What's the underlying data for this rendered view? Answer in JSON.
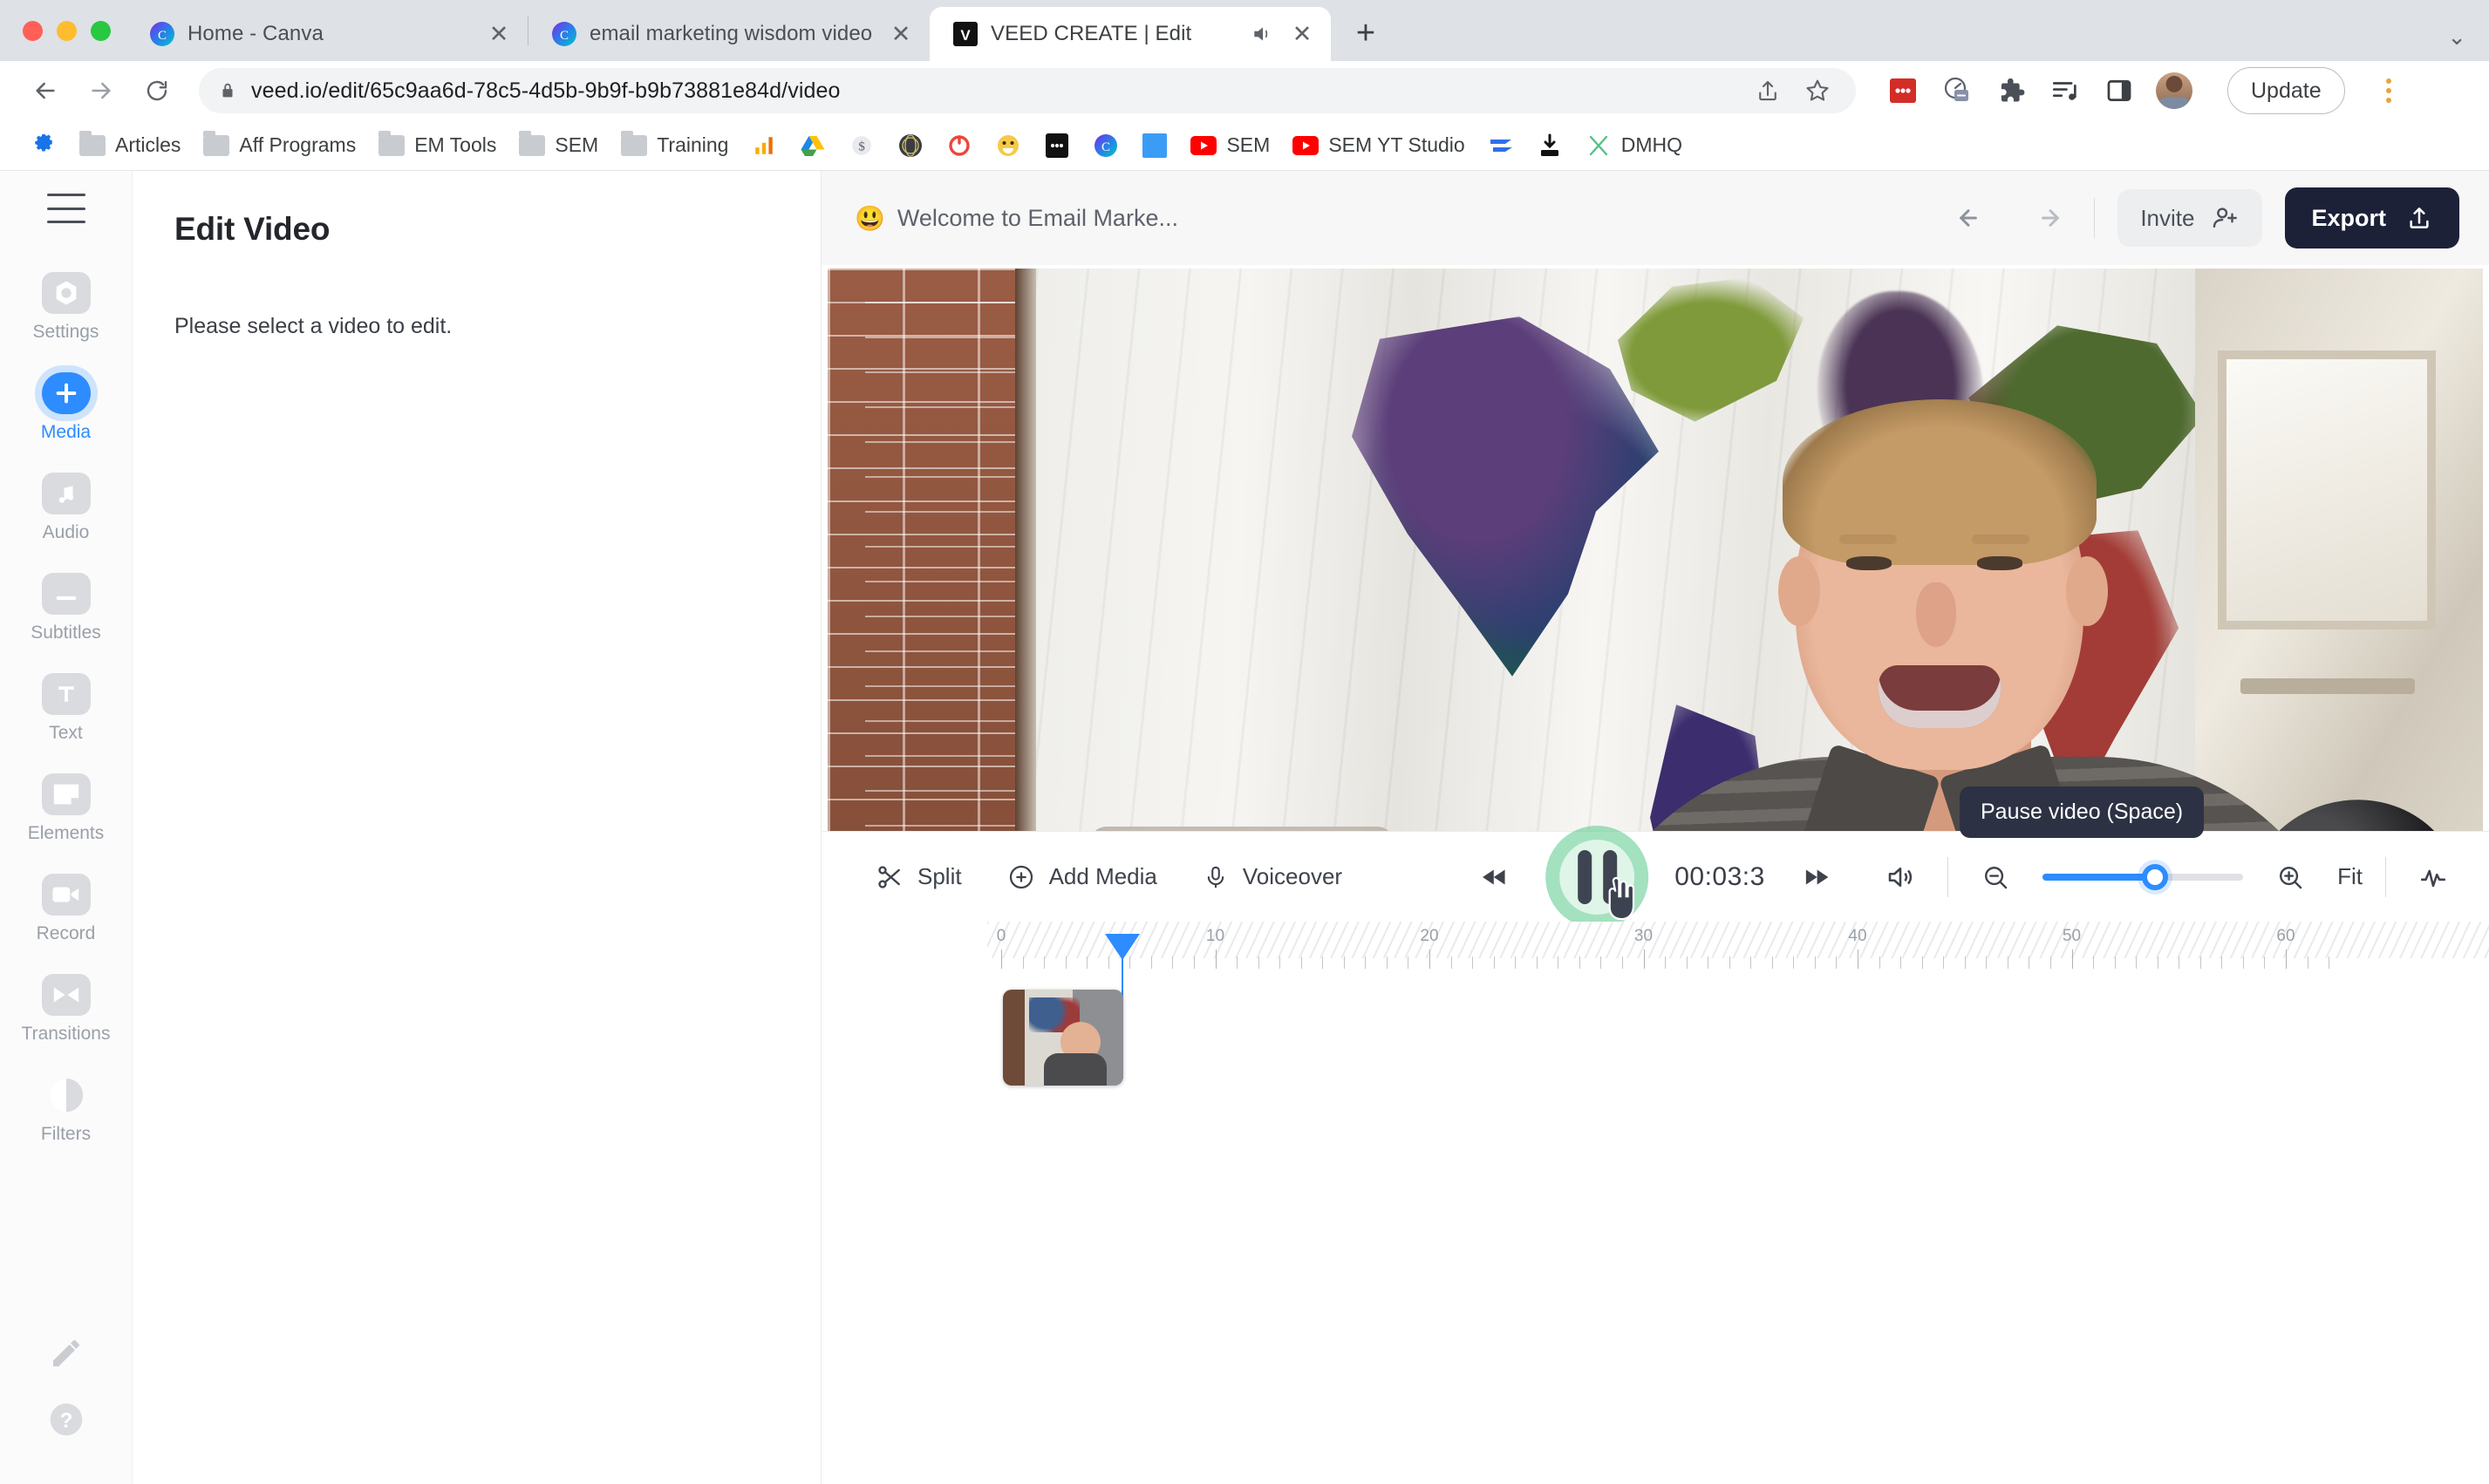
{
  "browser": {
    "tabs": [
      {
        "title": "Home - Canva",
        "favicon": "canva-icon",
        "active": false,
        "muted": false
      },
      {
        "title": "email marketing wisdom video",
        "favicon": "canva-icon",
        "active": false,
        "muted": false
      },
      {
        "title": "VEED CREATE | Edit",
        "favicon": "veed-icon",
        "active": true,
        "muted": true
      }
    ],
    "new_tab_label": "+",
    "tab_list_chevron": "chevron-down-icon",
    "nav": {
      "back": "back-arrow-icon",
      "forward": "forward-arrow-icon",
      "reload": "reload-icon"
    },
    "omnibox": {
      "url": "veed.io/edit/65c9aa6d-78c5-4d5b-9b9f-b9b73881e84d/video",
      "lock": "lock-icon",
      "share": "share-icon",
      "bookmark": "star-icon"
    },
    "extensions": [
      "lastpass-icon",
      "speed-dial-icon",
      "puzzle-extensions-icon",
      "reading-list-icon",
      "side-panel-icon"
    ],
    "profile": "profile-avatar",
    "update_label": "Update",
    "menu": "kebab-menu-icon",
    "bookmarks": [
      {
        "label": "",
        "icon": "settings-gear-icon"
      },
      {
        "label": "Articles",
        "icon": "folder-icon"
      },
      {
        "label": "Aff Programs",
        "icon": "folder-icon"
      },
      {
        "label": "EM Tools",
        "icon": "folder-icon"
      },
      {
        "label": "SEM",
        "icon": "folder-icon"
      },
      {
        "label": "Training",
        "icon": "folder-icon"
      },
      {
        "label": "",
        "icon": "analytics-icon"
      },
      {
        "label": "",
        "icon": "google-drive-icon"
      },
      {
        "label": "",
        "icon": "dollar-icon"
      },
      {
        "label": "",
        "icon": "dark-globe-icon"
      },
      {
        "label": "",
        "icon": "red-circle-icon"
      },
      {
        "label": "",
        "icon": "smiley-icon"
      },
      {
        "label": "",
        "icon": "black-app-icon"
      },
      {
        "label": "",
        "icon": "canva-icon"
      },
      {
        "label": "",
        "icon": "blue-square-icon"
      },
      {
        "label": "SEM",
        "icon": "youtube-icon"
      },
      {
        "label": "SEM YT Studio",
        "icon": "youtube-icon"
      },
      {
        "label": "",
        "icon": "blue-arrows-icon"
      },
      {
        "label": "",
        "icon": "download-icon"
      },
      {
        "label": "DMHQ",
        "icon": "x-icon"
      }
    ]
  },
  "app": {
    "hamburger": "menu-icon",
    "rail": [
      {
        "label": "Settings",
        "icon": "settings-icon",
        "active": false
      },
      {
        "label": "Media",
        "icon": "plus-icon",
        "active": true
      },
      {
        "label": "Audio",
        "icon": "music-note-icon",
        "active": false
      },
      {
        "label": "Subtitles",
        "icon": "subtitles-icon",
        "active": false
      },
      {
        "label": "Text",
        "icon": "text-t-icon",
        "active": false
      },
      {
        "label": "Elements",
        "icon": "elements-icon",
        "active": false
      },
      {
        "label": "Record",
        "icon": "video-camera-icon",
        "active": false
      },
      {
        "label": "Transitions",
        "icon": "transitions-icon",
        "active": false
      },
      {
        "label": "Filters",
        "icon": "contrast-circle-icon",
        "active": false
      }
    ],
    "rail_bottom": [
      {
        "icon": "pencil-icon"
      },
      {
        "icon": "help-question-icon"
      }
    ],
    "panel": {
      "title": "Edit Video",
      "message": "Please select a video to edit."
    },
    "stage_header": {
      "project_emoji": "😃",
      "project_title": "Welcome to Email Marke...",
      "undo": "undo-arrow-icon",
      "redo": "redo-arrow-icon",
      "invite_label": "Invite",
      "invite_icon": "add-person-icon",
      "export_label": "Export",
      "export_icon": "upload-icon"
    },
    "tooltip": "Pause video (Space)",
    "toolbar": {
      "split_label": "Split",
      "split_icon": "scissors-icon",
      "add_media_label": "Add Media",
      "add_media_icon": "plus-circle-icon",
      "voiceover_label": "Voiceover",
      "voiceover_icon": "microphone-icon",
      "skip_back_icon": "skip-back-icon",
      "skip_forward_icon": "skip-forward-icon",
      "play_pause_icon": "pause-icon",
      "timecode": "00:03:3",
      "volume_icon": "volume-icon",
      "zoom_out_icon": "zoom-out-icon",
      "zoom_in_icon": "zoom-in-icon",
      "zoom_value": 56,
      "fit_label": "Fit",
      "waveform_icon": "waveform-icon"
    },
    "timeline": {
      "tick_labels": [
        "0",
        "10",
        "20",
        "30",
        "40",
        "50",
        "60"
      ],
      "playhead_seconds": 3.3,
      "clip": {
        "name": "video-clip-thumbnail"
      }
    }
  },
  "colors": {
    "accent_blue": "#2d8cff",
    "export_dark": "#1c2138",
    "tooltip_dark": "#2c3144",
    "click_green": "#57c98a",
    "chrome_tabstrip": "#dee1e6"
  }
}
